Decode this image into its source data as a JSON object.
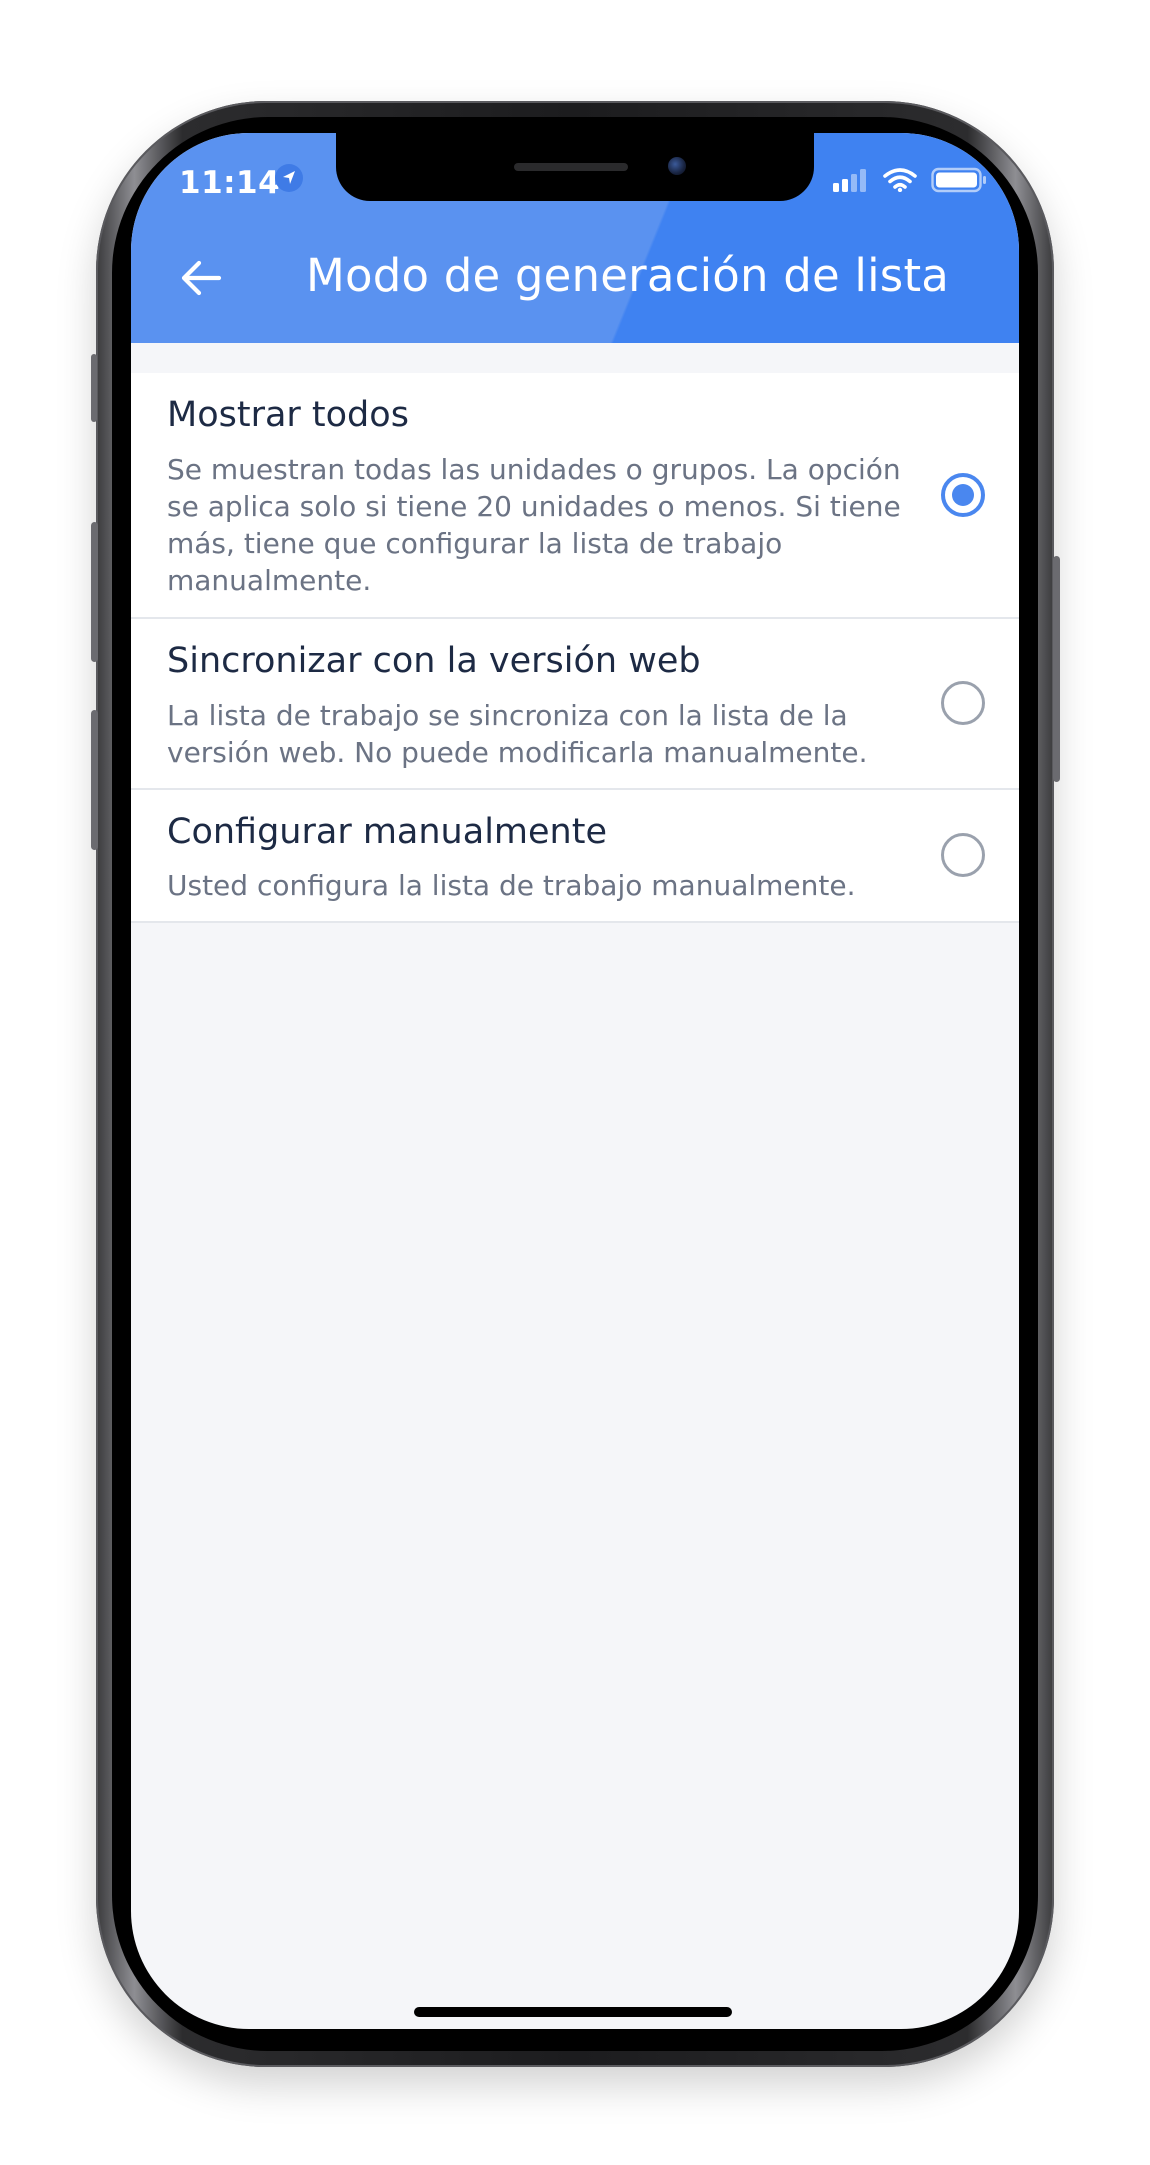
{
  "status_bar": {
    "time": "11:14",
    "location_icon": "location-arrow-icon",
    "signal_icon": "cellular-signal-icon",
    "wifi_icon": "wifi-icon",
    "battery_icon": "battery-icon"
  },
  "header": {
    "title": "Modo de generación de lista",
    "back_icon": "arrow-left-icon"
  },
  "options": [
    {
      "title": "Mostrar todos",
      "description": "Se muestran todas las unidades o grupos. La opción se aplica solo si tiene 20 unidades o menos. Si tiene más, tiene que configurar la lista de trabajo manualmente.",
      "selected": true
    },
    {
      "title": "Sincronizar con la versión web",
      "description": "La lista de trabajo se sincroniza con la lista de la versión web. No puede modificarla manualmente.",
      "selected": false
    },
    {
      "title": "Configurar manualmente",
      "description": "Usted configura la lista de trabajo manualmente.",
      "selected": false
    }
  ],
  "colors": {
    "header": "#5a92f0",
    "accent": "#4a87ef",
    "background": "#f5f6f9"
  }
}
